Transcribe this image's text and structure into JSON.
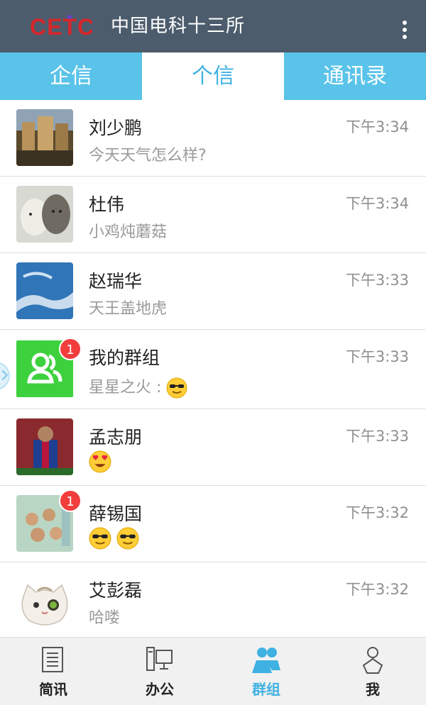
{
  "header": {
    "logo_text": "CETC",
    "title": "中国电科十三所",
    "more_icon": "more-vertical-icon"
  },
  "tabs": [
    {
      "label": "企信",
      "active": false
    },
    {
      "label": "个信",
      "active": true
    },
    {
      "label": "通讯录",
      "active": false
    }
  ],
  "conversations": [
    {
      "name": "刘少鹏",
      "preview": "今天天气怎么样?",
      "time": "下午3:34",
      "avatar": "building-photo"
    },
    {
      "name": "杜伟",
      "preview": "小鸡炖蘑菇",
      "time": "下午3:34",
      "avatar": "sheep-wolf-photo"
    },
    {
      "name": "赵瑞华",
      "preview": "天王盖地虎",
      "time": "下午3:33",
      "avatar": "sky-photo"
    },
    {
      "name": "我的群组",
      "preview": "星星之火 :",
      "time": "下午3:33",
      "avatar": "group-icon",
      "badge": "1",
      "emoji": [
        "sunglasses-emoji"
      ]
    },
    {
      "name": "孟志朋",
      "preview": "",
      "time": "下午3:33",
      "avatar": "soccer-player-photo",
      "emoji": [
        "heart-eyes-emoji"
      ]
    },
    {
      "name": "薛锡国",
      "preview": "",
      "time": "下午3:32",
      "avatar": "band-photo",
      "badge": "1",
      "emoji": [
        "sunglasses-emoji",
        "sunglasses-emoji"
      ]
    },
    {
      "name": "艾彭磊",
      "preview": "哈喽",
      "time": "下午3:32",
      "avatar": "cat-cartoon"
    }
  ],
  "bottom_nav": [
    {
      "label": "简讯",
      "icon": "document-icon",
      "active": false
    },
    {
      "label": "办公",
      "icon": "computer-icon",
      "active": false
    },
    {
      "label": "群组",
      "icon": "group-people-icon",
      "active": true
    },
    {
      "label": "我",
      "icon": "person-icon",
      "active": false
    }
  ],
  "colors": {
    "header_bg": "#4c5c6c",
    "tab_bg": "#5ac3e9",
    "accent": "#3fb1e2",
    "badge": "#f23d3d"
  }
}
